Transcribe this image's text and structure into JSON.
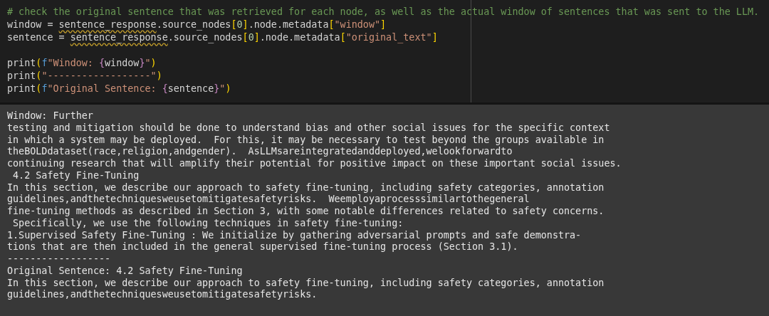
{
  "code_cell": {
    "lines": [
      {
        "kind": "code",
        "tokens": [
          {
            "kind": "comment",
            "text": "# check the original sentence that was retrieved for each node, as well as the actual window of sentences that was sent to the LLM."
          }
        ]
      },
      {
        "kind": "code",
        "tokens": [
          {
            "kind": "plain",
            "text": "window = "
          },
          {
            "kind": "warned",
            "text": "sentence_response"
          },
          {
            "kind": "plain",
            "text": ".source_nodes"
          },
          {
            "kind": "bracket",
            "text": "["
          },
          {
            "kind": "number",
            "text": "0"
          },
          {
            "kind": "bracket",
            "text": "]"
          },
          {
            "kind": "plain",
            "text": ".node.metadata"
          },
          {
            "kind": "bracket",
            "text": "["
          },
          {
            "kind": "string",
            "text": "\"window\""
          },
          {
            "kind": "bracket",
            "text": "]"
          }
        ]
      },
      {
        "kind": "code",
        "tokens": [
          {
            "kind": "plain",
            "text": "sentence = "
          },
          {
            "kind": "warned",
            "text": "sentence_response"
          },
          {
            "kind": "plain",
            "text": ".source_nodes"
          },
          {
            "kind": "bracket",
            "text": "["
          },
          {
            "kind": "number",
            "text": "0"
          },
          {
            "kind": "bracket",
            "text": "]"
          },
          {
            "kind": "plain",
            "text": ".node.metadata"
          },
          {
            "kind": "bracket",
            "text": "["
          },
          {
            "kind": "string",
            "text": "\"original_text\""
          },
          {
            "kind": "bracket",
            "text": "]"
          }
        ]
      },
      {
        "kind": "blank"
      },
      {
        "kind": "code",
        "tokens": [
          {
            "kind": "plain",
            "text": "print"
          },
          {
            "kind": "bracket",
            "text": "("
          },
          {
            "kind": "prefix",
            "text": "f"
          },
          {
            "kind": "string",
            "text": "\"Window: "
          },
          {
            "kind": "brace",
            "text": "{"
          },
          {
            "kind": "plain",
            "text": "window"
          },
          {
            "kind": "brace",
            "text": "}"
          },
          {
            "kind": "string",
            "text": "\""
          },
          {
            "kind": "bracket",
            "text": ")"
          }
        ]
      },
      {
        "kind": "code",
        "tokens": [
          {
            "kind": "plain",
            "text": "print"
          },
          {
            "kind": "bracket",
            "text": "("
          },
          {
            "kind": "string",
            "text": "\"------------------\""
          },
          {
            "kind": "bracket",
            "text": ")"
          }
        ]
      },
      {
        "kind": "code",
        "tokens": [
          {
            "kind": "plain",
            "text": "print"
          },
          {
            "kind": "bracket",
            "text": "("
          },
          {
            "kind": "prefix",
            "text": "f"
          },
          {
            "kind": "string",
            "text": "\"Original Sentence: "
          },
          {
            "kind": "brace",
            "text": "{"
          },
          {
            "kind": "plain",
            "text": "sentence"
          },
          {
            "kind": "brace",
            "text": "}"
          },
          {
            "kind": "string",
            "text": "\""
          },
          {
            "kind": "bracket",
            "text": ")"
          }
        ]
      }
    ]
  },
  "output": {
    "lines": [
      "Window: Further",
      "testing and mitigation should be done to understand bias and other social issues for the specific context",
      "in which a system may be deployed.  For this, it may be necessary to test beyond the groups available in",
      "theBOLDdataset(race,religion,andgender).  AsLLMsareintegratedanddeployed,welookforwardto",
      "continuing research that will amplify their potential for positive impact on these important social issues.",
      " 4.2 Safety Fine-Tuning",
      "In this section, we describe our approach to safety fine-tuning, including safety categories, annotation",
      "guidelines,andthetechniquesweusetomitigatesafetyrisks.  Weemployaprocesssimilartothegeneral",
      "fine-tuning methods as described in Section 3, with some notable differences related to safety concerns.",
      " Specifically, we use the following techniques in safety fine-tuning:",
      "1.Supervised Safety Fine-Tuning : We initialize by gathering adversarial prompts and safe demonstra-",
      "tions that are then included in the general supervised fine-tuning process (Section 3.1).",
      "------------------",
      "Original Sentence: 4.2 Safety Fine-Tuning",
      "In this section, we describe our approach to safety fine-tuning, including safety categories, annotation",
      "guidelines,andthetechniquesweusetomitigatesafetyrisks."
    ]
  }
}
